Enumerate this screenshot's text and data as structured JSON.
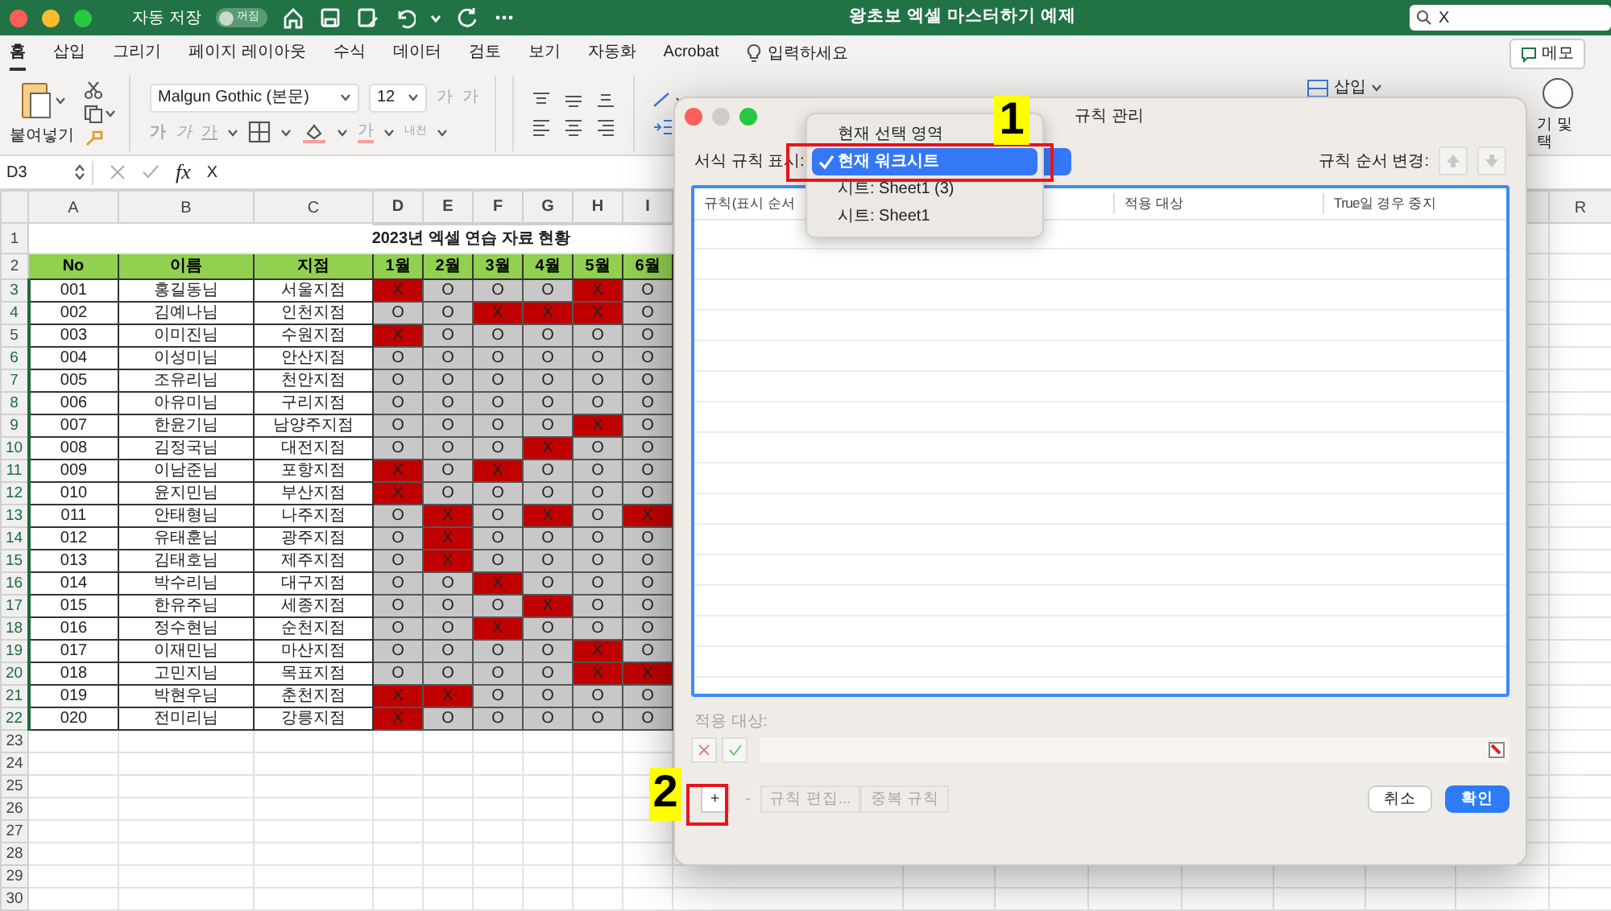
{
  "window": {
    "title": "왕초보 엑셀 마스터하기 예제",
    "autosave_label": "자동 저장",
    "autosave_toggle": {
      "label": "꺼짐",
      "on": false
    }
  },
  "search": {
    "value": "X"
  },
  "ribbon_tabs": [
    {
      "label": "홈",
      "selected": true
    },
    {
      "label": "삽입",
      "selected": false
    },
    {
      "label": "그리기",
      "selected": false
    },
    {
      "label": "페이지 레이아웃",
      "selected": false
    },
    {
      "label": "수식",
      "selected": false
    },
    {
      "label": "데이터",
      "selected": false
    },
    {
      "label": "검토",
      "selected": false
    },
    {
      "label": "보기",
      "selected": false
    },
    {
      "label": "자동화",
      "selected": false
    },
    {
      "label": "Acrobat",
      "selected": false
    }
  ],
  "tell_me": "입력하세요",
  "memo_button": "메모",
  "ribbon": {
    "paste_label": "붙여넣기",
    "font_name": "Malgun Gothic (본문)",
    "font_size": "12",
    "grow_label": "가",
    "shrink_label": "가",
    "bold_label": "가",
    "italic_label": "가",
    "underline_label": "가",
    "font_color_label": "가",
    "phonetic_label": "내천",
    "insert_label": "삽입",
    "find_select_lines": [
      "기 및",
      "택"
    ]
  },
  "formula_bar": {
    "cell_ref": "D3",
    "fx": "fx",
    "value": "X"
  },
  "sheet": {
    "columns": [
      {
        "label": "A",
        "selected": false
      },
      {
        "label": "B",
        "selected": false
      },
      {
        "label": "C",
        "selected": false
      },
      {
        "label": "D",
        "selected": true
      },
      {
        "label": "E",
        "selected": true
      },
      {
        "label": "F",
        "selected": true
      },
      {
        "label": "G",
        "selected": true
      },
      {
        "label": "H",
        "selected": true
      },
      {
        "label": "I",
        "selected": true
      }
    ],
    "right_column": "R",
    "row_numbers": [
      {
        "label": "1",
        "selected": false
      },
      {
        "label": "2",
        "selected": false
      },
      {
        "label": "3",
        "selected": true
      },
      {
        "label": "4",
        "selected": true
      },
      {
        "label": "5",
        "selected": true
      },
      {
        "label": "6",
        "selected": true
      },
      {
        "label": "7",
        "selected": true
      },
      {
        "label": "8",
        "selected": true
      },
      {
        "label": "9",
        "selected": true
      },
      {
        "label": "10",
        "selected": true
      },
      {
        "label": "11",
        "selected": true
      },
      {
        "label": "12",
        "selected": true
      },
      {
        "label": "13",
        "selected": true
      },
      {
        "label": "14",
        "selected": true
      },
      {
        "label": "15",
        "selected": true
      },
      {
        "label": "16",
        "selected": true
      },
      {
        "label": "17",
        "selected": true
      },
      {
        "label": "18",
        "selected": true
      },
      {
        "label": "19",
        "selected": true
      },
      {
        "label": "20",
        "selected": true
      },
      {
        "label": "21",
        "selected": true
      },
      {
        "label": "22",
        "selected": true
      },
      {
        "label": "23",
        "selected": false
      },
      {
        "label": "24",
        "selected": false
      },
      {
        "label": "25",
        "selected": false
      },
      {
        "label": "26",
        "selected": false
      },
      {
        "label": "27",
        "selected": false
      },
      {
        "label": "28",
        "selected": false
      },
      {
        "label": "29",
        "selected": false
      },
      {
        "label": "30",
        "selected": false
      }
    ],
    "title": "2023년 엑셀 연습 자료 현황",
    "headers": [
      "No",
      "이름",
      "지점",
      "1월",
      "2월",
      "3월",
      "4월",
      "5월",
      "6월"
    ],
    "records": [
      {
        "no": "001",
        "name": "홍길동님",
        "branch": "서울지점",
        "months": [
          {
            "mark": "X",
            "flagged": true
          },
          {
            "mark": "O",
            "flagged": false
          },
          {
            "mark": "O",
            "flagged": false
          },
          {
            "mark": "O",
            "flagged": false
          },
          {
            "mark": "X",
            "flagged": true
          },
          {
            "mark": "O",
            "flagged": false
          }
        ]
      },
      {
        "no": "002",
        "name": "김예나님",
        "branch": "인천지점",
        "months": [
          {
            "mark": "O",
            "flagged": false
          },
          {
            "mark": "O",
            "flagged": false
          },
          {
            "mark": "X",
            "flagged": true
          },
          {
            "mark": "X",
            "flagged": true
          },
          {
            "mark": "X",
            "flagged": true
          },
          {
            "mark": "O",
            "flagged": false
          }
        ]
      },
      {
        "no": "003",
        "name": "이미진님",
        "branch": "수원지점",
        "months": [
          {
            "mark": "X",
            "flagged": true
          },
          {
            "mark": "O",
            "flagged": false
          },
          {
            "mark": "O",
            "flagged": false
          },
          {
            "mark": "O",
            "flagged": false
          },
          {
            "mark": "O",
            "flagged": false
          },
          {
            "mark": "O",
            "flagged": false
          }
        ]
      },
      {
        "no": "004",
        "name": "이성미님",
        "branch": "안산지점",
        "months": [
          {
            "mark": "O",
            "flagged": false
          },
          {
            "mark": "O",
            "flagged": false
          },
          {
            "mark": "O",
            "flagged": false
          },
          {
            "mark": "O",
            "flagged": false
          },
          {
            "mark": "O",
            "flagged": false
          },
          {
            "mark": "O",
            "flagged": false
          }
        ]
      },
      {
        "no": "005",
        "name": "조유리님",
        "branch": "천안지점",
        "months": [
          {
            "mark": "O",
            "flagged": false
          },
          {
            "mark": "O",
            "flagged": false
          },
          {
            "mark": "O",
            "flagged": false
          },
          {
            "mark": "O",
            "flagged": false
          },
          {
            "mark": "O",
            "flagged": false
          },
          {
            "mark": "O",
            "flagged": false
          }
        ]
      },
      {
        "no": "006",
        "name": "아유미님",
        "branch": "구리지점",
        "months": [
          {
            "mark": "O",
            "flagged": false
          },
          {
            "mark": "O",
            "flagged": false
          },
          {
            "mark": "O",
            "flagged": false
          },
          {
            "mark": "O",
            "flagged": false
          },
          {
            "mark": "O",
            "flagged": false
          },
          {
            "mark": "O",
            "flagged": false
          }
        ]
      },
      {
        "no": "007",
        "name": "한윤기님",
        "branch": "남양주지점",
        "months": [
          {
            "mark": "O",
            "flagged": false
          },
          {
            "mark": "O",
            "flagged": false
          },
          {
            "mark": "O",
            "flagged": false
          },
          {
            "mark": "O",
            "flagged": false
          },
          {
            "mark": "X",
            "flagged": true
          },
          {
            "mark": "O",
            "flagged": false
          }
        ]
      },
      {
        "no": "008",
        "name": "김정국님",
        "branch": "대전지점",
        "months": [
          {
            "mark": "O",
            "flagged": false
          },
          {
            "mark": "O",
            "flagged": false
          },
          {
            "mark": "O",
            "flagged": false
          },
          {
            "mark": "X",
            "flagged": true
          },
          {
            "mark": "O",
            "flagged": false
          },
          {
            "mark": "O",
            "flagged": false
          }
        ]
      },
      {
        "no": "009",
        "name": "이남준님",
        "branch": "포항지점",
        "months": [
          {
            "mark": "X",
            "flagged": true
          },
          {
            "mark": "O",
            "flagged": false
          },
          {
            "mark": "X",
            "flagged": true
          },
          {
            "mark": "O",
            "flagged": false
          },
          {
            "mark": "O",
            "flagged": false
          },
          {
            "mark": "O",
            "flagged": false
          }
        ]
      },
      {
        "no": "010",
        "name": "윤지민님",
        "branch": "부산지점",
        "months": [
          {
            "mark": "X",
            "flagged": true
          },
          {
            "mark": "O",
            "flagged": false
          },
          {
            "mark": "O",
            "flagged": false
          },
          {
            "mark": "O",
            "flagged": false
          },
          {
            "mark": "O",
            "flagged": false
          },
          {
            "mark": "O",
            "flagged": false
          }
        ]
      },
      {
        "no": "011",
        "name": "안태형님",
        "branch": "나주지점",
        "months": [
          {
            "mark": "O",
            "flagged": false
          },
          {
            "mark": "X",
            "flagged": true
          },
          {
            "mark": "O",
            "flagged": false
          },
          {
            "mark": "X",
            "flagged": true
          },
          {
            "mark": "O",
            "flagged": false
          },
          {
            "mark": "X",
            "flagged": true
          }
        ]
      },
      {
        "no": "012",
        "name": "유태훈님",
        "branch": "광주지점",
        "months": [
          {
            "mark": "O",
            "flagged": false
          },
          {
            "mark": "X",
            "flagged": true
          },
          {
            "mark": "O",
            "flagged": false
          },
          {
            "mark": "O",
            "flagged": false
          },
          {
            "mark": "O",
            "flagged": false
          },
          {
            "mark": "O",
            "flagged": false
          }
        ]
      },
      {
        "no": "013",
        "name": "김태호님",
        "branch": "제주지점",
        "months": [
          {
            "mark": "O",
            "flagged": false
          },
          {
            "mark": "X",
            "flagged": true
          },
          {
            "mark": "O",
            "flagged": false
          },
          {
            "mark": "O",
            "flagged": false
          },
          {
            "mark": "O",
            "flagged": false
          },
          {
            "mark": "O",
            "flagged": false
          }
        ]
      },
      {
        "no": "014",
        "name": "박수리님",
        "branch": "대구지점",
        "months": [
          {
            "mark": "O",
            "flagged": false
          },
          {
            "mark": "O",
            "flagged": false
          },
          {
            "mark": "X",
            "flagged": true
          },
          {
            "mark": "O",
            "flagged": false
          },
          {
            "mark": "O",
            "flagged": false
          },
          {
            "mark": "O",
            "flagged": false
          }
        ]
      },
      {
        "no": "015",
        "name": "한유주님",
        "branch": "세종지점",
        "months": [
          {
            "mark": "O",
            "flagged": false
          },
          {
            "mark": "O",
            "flagged": false
          },
          {
            "mark": "O",
            "flagged": false
          },
          {
            "mark": "X",
            "flagged": true
          },
          {
            "mark": "O",
            "flagged": false
          },
          {
            "mark": "O",
            "flagged": false
          }
        ]
      },
      {
        "no": "016",
        "name": "정수현님",
        "branch": "순천지점",
        "months": [
          {
            "mark": "O",
            "flagged": false
          },
          {
            "mark": "O",
            "flagged": false
          },
          {
            "mark": "X",
            "flagged": true
          },
          {
            "mark": "O",
            "flagged": false
          },
          {
            "mark": "O",
            "flagged": false
          },
          {
            "mark": "O",
            "flagged": false
          }
        ]
      },
      {
        "no": "017",
        "name": "이재민님",
        "branch": "마산지점",
        "months": [
          {
            "mark": "O",
            "flagged": false
          },
          {
            "mark": "O",
            "flagged": false
          },
          {
            "mark": "O",
            "flagged": false
          },
          {
            "mark": "O",
            "flagged": false
          },
          {
            "mark": "X",
            "flagged": true
          },
          {
            "mark": "O",
            "flagged": false
          }
        ]
      },
      {
        "no": "018",
        "name": "고민지님",
        "branch": "목표지점",
        "months": [
          {
            "mark": "O",
            "flagged": false
          },
          {
            "mark": "O",
            "flagged": false
          },
          {
            "mark": "O",
            "flagged": false
          },
          {
            "mark": "O",
            "flagged": false
          },
          {
            "mark": "X",
            "flagged": true
          },
          {
            "mark": "X",
            "flagged": true
          }
        ]
      },
      {
        "no": "019",
        "name": "박현우님",
        "branch": "춘천지점",
        "months": [
          {
            "mark": "X",
            "flagged": true
          },
          {
            "mark": "X",
            "flagged": true
          },
          {
            "mark": "O",
            "flagged": false
          },
          {
            "mark": "O",
            "flagged": false
          },
          {
            "mark": "O",
            "flagged": false
          },
          {
            "mark": "O",
            "flagged": false
          }
        ]
      },
      {
        "no": "020",
        "name": "전미리님",
        "branch": "강릉지점",
        "months": [
          {
            "mark": "X",
            "flagged": true
          },
          {
            "mark": "O",
            "flagged": false
          },
          {
            "mark": "O",
            "flagged": false
          },
          {
            "mark": "O",
            "flagged": false
          },
          {
            "mark": "O",
            "flagged": false
          },
          {
            "mark": "O",
            "flagged": false
          }
        ]
      }
    ]
  },
  "dialog": {
    "title": "규칙 관리",
    "show_rules_label": "서식 규칙 표시:",
    "order_label": "규칙 순서 변경:",
    "columns": [
      "규칙(표시 순서",
      "적용 대상",
      "True일 경우 중지"
    ],
    "applies_label": "적용 대상:",
    "menu": [
      {
        "label": "현재 선택 영역",
        "selected": false
      },
      {
        "label": "현재 워크시트",
        "selected": true
      },
      {
        "label": "시트: Sheet1 (3)",
        "selected": false
      },
      {
        "label": "시트: Sheet1",
        "selected": false
      }
    ],
    "rule_buttons": [
      {
        "label": "+",
        "disabled": false
      },
      {
        "label": "-",
        "disabled": true
      },
      {
        "label": "규칙 편집...",
        "disabled": true
      },
      {
        "label": "중복 규칙",
        "disabled": true
      }
    ],
    "cancel": "취소",
    "ok": "확인"
  },
  "annotations": [
    {
      "label": "1"
    },
    {
      "label": "2"
    }
  ]
}
